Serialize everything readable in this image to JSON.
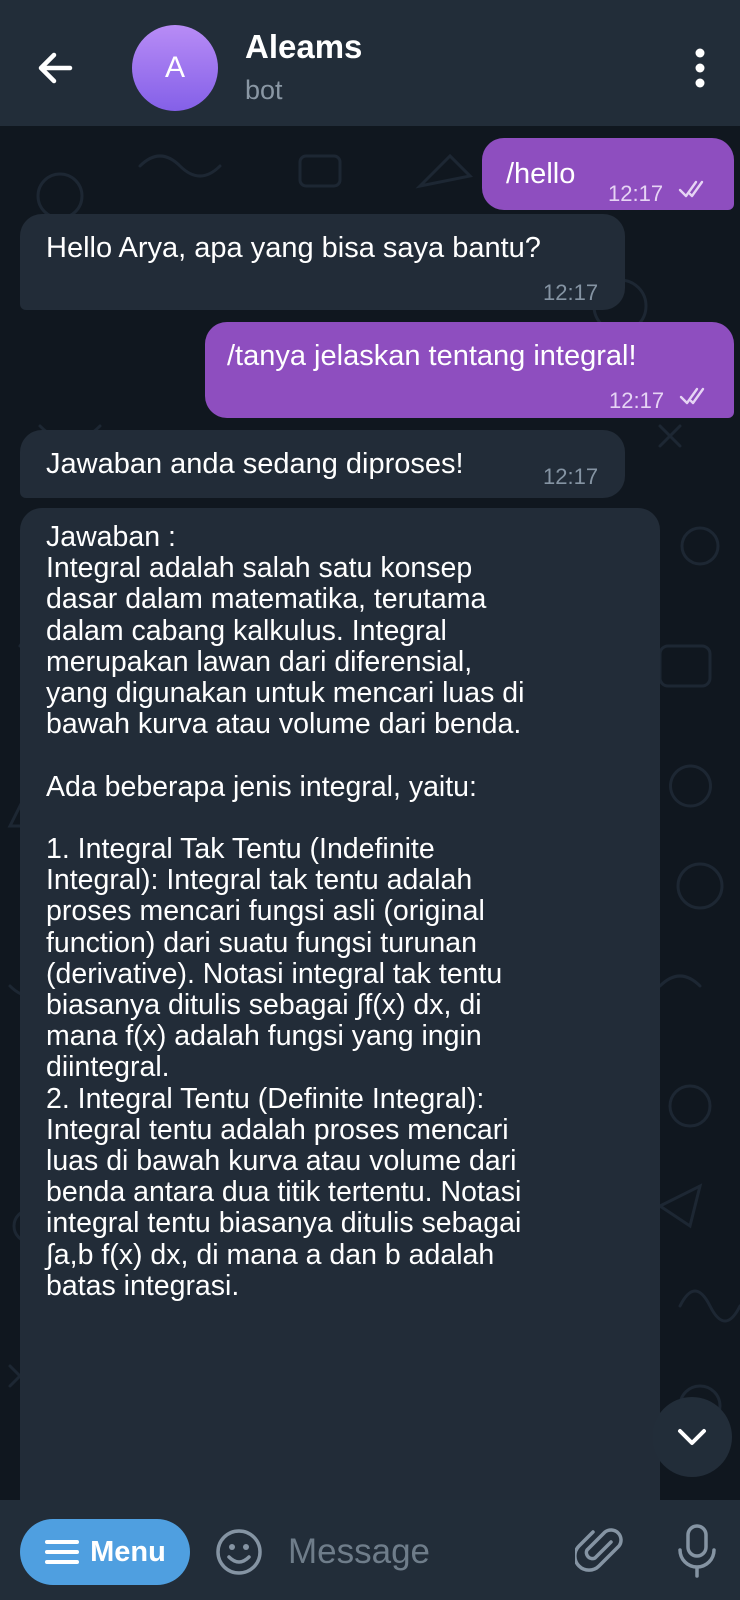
{
  "header": {
    "title": "Aleams",
    "subtitle": "bot",
    "avatar_letter": "A",
    "back_icon": "arrow-left-icon",
    "menu_icon": "more-vertical-icon"
  },
  "messages": [
    {
      "direction": "out",
      "text": "/hello",
      "time": "12:17",
      "status": "read"
    },
    {
      "direction": "in",
      "text": "Hello Arya, apa yang bisa saya bantu?",
      "time": "12:17"
    },
    {
      "direction": "out",
      "text": "/tanya jelaskan tentang integral!",
      "time": "12:17",
      "status": "read"
    },
    {
      "direction": "in",
      "text": "Jawaban anda sedang diproses!",
      "time": "12:17"
    },
    {
      "direction": "in",
      "text": "Jawaban :\nIntegral adalah salah satu konsep\ndasar dalam matematika, terutama\ndalam cabang kalkulus. Integral\nmerupakan lawan dari diferensial,\nyang digunakan untuk mencari luas di\nbawah kurva atau volume dari benda.\n\nAda beberapa jenis integral, yaitu:\n\n1. Integral Tak Tentu (Indefinite\nIntegral): Integral tak tentu adalah\nproses mencari fungsi asli (original\nfunction) dari suatu fungsi turunan\n(derivative). Notasi integral tak tentu\nbiasanya ditulis sebagai ∫f(x) dx, di\nmana f(x) adalah fungsi yang ingin\ndiintegral.\n2. Integral Tentu (Definite Integral):\nIntegral tentu adalah proses mencari\nluas di bawah kurva atau volume dari\nbenda antara dua titik tertentu. Notasi\nintegral tentu biasanya ditulis sebagai\n∫a,b f(x) dx, di mana a dan b adalah\nbatas integrasi."
    }
  ],
  "composer": {
    "menu_label": "Menu",
    "placeholder": "Message",
    "emoji_icon": "smile-icon",
    "attach_icon": "paperclip-icon",
    "mic_icon": "microphone-icon"
  },
  "scroll_icon": "chevron-down-icon",
  "colors": {
    "header_bg": "#222d39",
    "chat_bg": "#10171f",
    "outgoing_bubble": "#8e4ebf",
    "incoming_bubble": "#222c38",
    "menu_button": "#4f9fe0",
    "avatar_gradient_top": "#b88cf6",
    "avatar_gradient_bottom": "#8460e8"
  }
}
